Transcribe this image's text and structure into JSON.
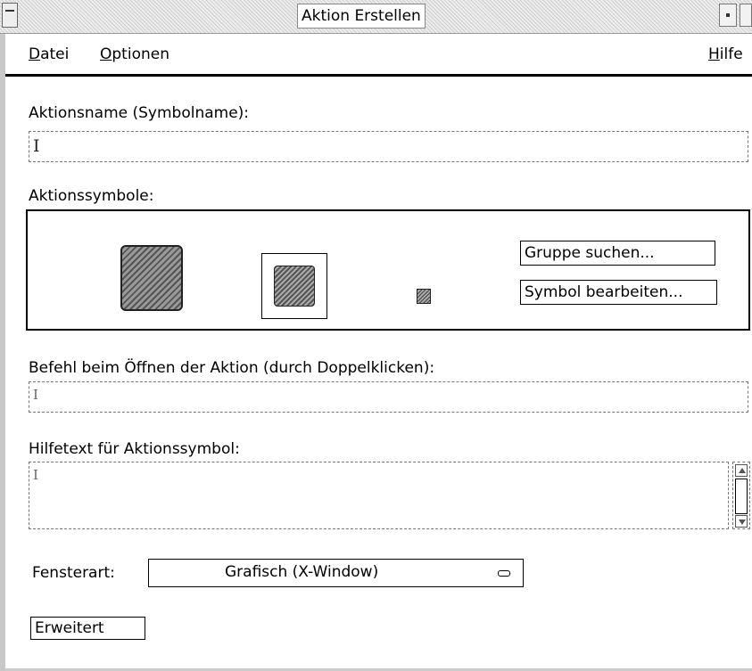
{
  "window": {
    "title": "Aktion Erstellen"
  },
  "menubar": {
    "datei_u": "D",
    "datei_rest": "atei",
    "optionen_u": "O",
    "optionen_rest": "ptionen",
    "hilfe_u": "H",
    "hilfe_rest": "ilfe"
  },
  "action_name": {
    "label": "Aktionsname (Symbolname):",
    "value": ""
  },
  "icons": {
    "label": "Aktionssymbole:",
    "find_set_button": "Gruppe suchen...",
    "edit_icon_button": "Symbol bearbeiten..."
  },
  "command": {
    "label": "Befehl beim Öffnen der Aktion (durch Doppelklicken):",
    "value": ""
  },
  "help_text": {
    "label": "Hilfetext für Aktionssymbol:",
    "value": ""
  },
  "window_type": {
    "label": "Fensterart:",
    "selected": "Grafisch (X-Window)"
  },
  "advanced_button": "Erweitert",
  "caret_glyph": "I"
}
